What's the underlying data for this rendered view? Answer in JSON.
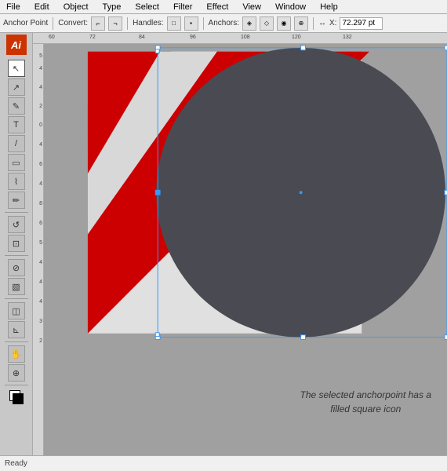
{
  "menubar": {
    "items": [
      "File",
      "Edit",
      "Object",
      "Type",
      "Select",
      "Filter",
      "Effect",
      "View",
      "Window",
      "Help"
    ]
  },
  "toolbar": {
    "anchor_label": "Anchor Point",
    "convert_label": "Convert:",
    "handles_label": "Handles:",
    "anchors_label": "Anchors:",
    "x_label": "X:",
    "x_value": "72.297 pt",
    "btn1": "⌐",
    "btn2": "¬",
    "btn3": "□",
    "btn4": "▪",
    "btn5": "◈",
    "btn6": "◇",
    "btn7": "◉"
  },
  "toolbox": {
    "logo": "Ai",
    "tools": [
      "↖",
      "⊹",
      "✎",
      "◯",
      "▭",
      "✂",
      "⊘",
      "T",
      "◈",
      "⊕",
      "⊗",
      "⌇",
      "⊡",
      "⋮⋮",
      "▧",
      "◫",
      "⊾",
      "🖐",
      "✦",
      "◎",
      "⬜"
    ]
  },
  "ruler": {
    "h_marks": [
      "60",
      "72",
      "84",
      "96",
      "108",
      "120",
      "132"
    ],
    "v_marks": [
      "5",
      "4",
      "4",
      "2",
      "0",
      "4",
      "6",
      "4",
      "8",
      "6",
      "5",
      "4",
      "4",
      "4",
      "3",
      "2"
    ]
  },
  "canvas": {
    "annotation_line1": "The selected anchorpoint has a",
    "annotation_line2": "filled square icon"
  }
}
